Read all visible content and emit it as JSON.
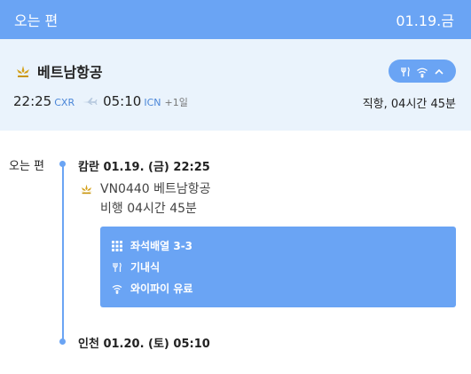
{
  "header": {
    "title": "오는 편",
    "date": "01.19.금"
  },
  "summary": {
    "airline": "베트남항공",
    "dep_time": "22:25",
    "dep_code": "CXR",
    "arr_time": "05:10",
    "arr_code": "ICN",
    "day_offset": "+1일",
    "route_info": "직항, 04시간 45분",
    "amenity_icons": [
      "meal-icon",
      "wifi-icon",
      "chevron-up-icon"
    ]
  },
  "itinerary": {
    "leg_label": "오는 편",
    "departure": "캄란 01.19. (금) 22:25",
    "flight": "VN0440 베트남항공",
    "duration": "비행 04시간 45분",
    "amenities": [
      {
        "icon": "seat-grid-icon",
        "label": "좌석배열 3-3"
      },
      {
        "icon": "meal-icon",
        "label": "기내식"
      },
      {
        "icon": "wifi-icon",
        "label": "와이파이 유료"
      }
    ],
    "arrival": "인천 01.20. (토) 05:10"
  },
  "colors": {
    "accent": "#6aa4f4",
    "summary_bg": "#eaf3fc",
    "logo": "#d4a017"
  }
}
